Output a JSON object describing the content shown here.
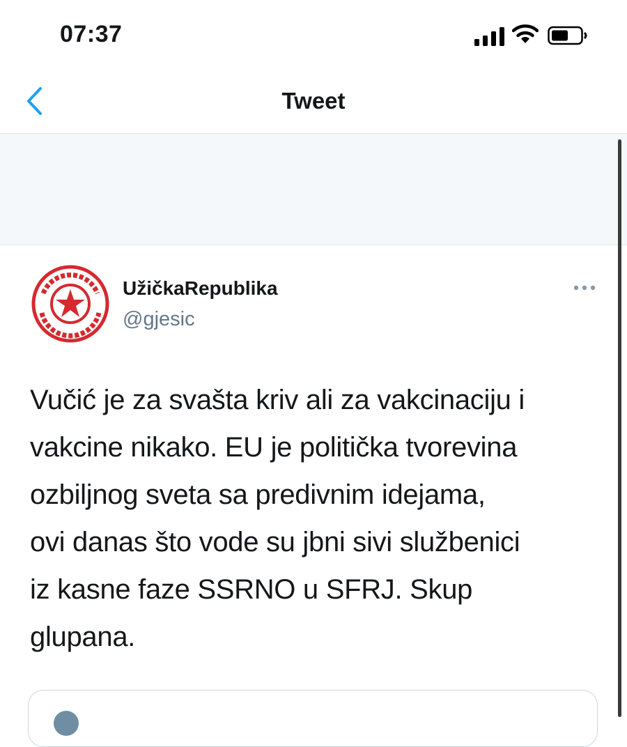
{
  "status_bar": {
    "time": "07:37"
  },
  "nav": {
    "title": "Tweet"
  },
  "tweet": {
    "author": {
      "display_name": "UžičkaRepublika",
      "handle": "@gjesic"
    },
    "text_lines": [
      "Vučić je za svašta kriv ali za vakcinaciju i",
      "vakcine nikako. EU je politička tvorevina",
      "ozbiljnog sveta sa predivnim idejama,",
      "ovi danas što vode su jbni sivi službenici",
      "iz kasne faze SSRNO u SFRJ. Skup",
      "glupana."
    ]
  },
  "colors": {
    "accent": "#1da1f2",
    "text": "#14171a",
    "secondary": "#657786",
    "seal_red": "#d42a2f"
  },
  "icons": {
    "signal": "signal-icon",
    "wifi": "wifi-icon",
    "battery": "battery-icon",
    "back": "back-chevron-icon",
    "more": "more-options-icon"
  }
}
